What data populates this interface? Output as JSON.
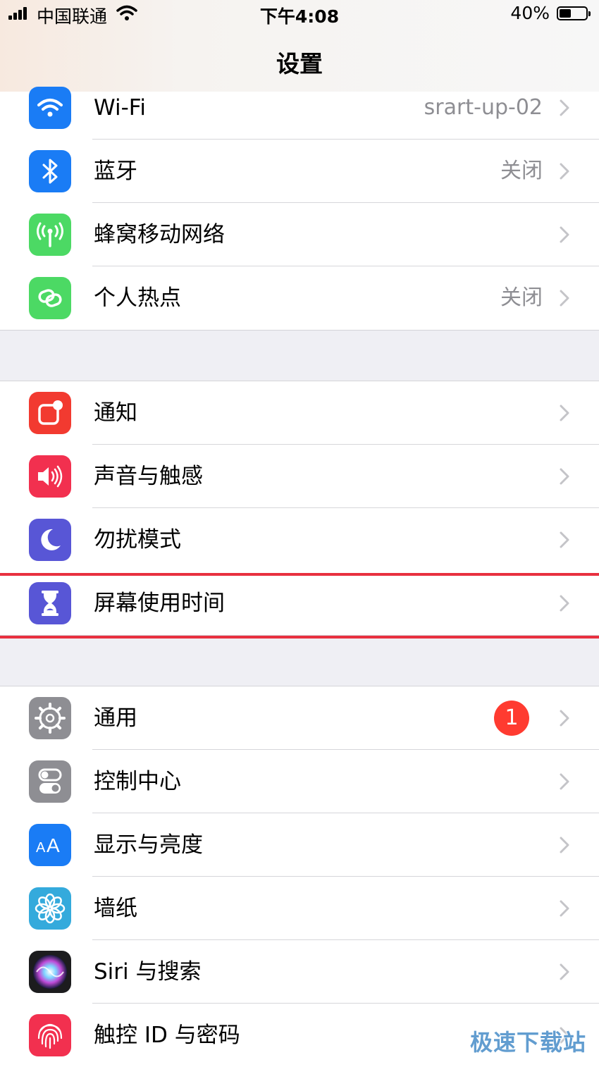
{
  "status_bar": {
    "carrier": "中国联通",
    "time": "下午4:08",
    "battery": "40%",
    "battery_level": 0.4,
    "signal_icon": "signal-bars-icon",
    "wifi_icon": "wifi-icon"
  },
  "nav": {
    "title": "设置"
  },
  "groups": [
    {
      "rows": [
        {
          "label": "Wi-Fi",
          "value": "srart-up-02",
          "icon": "wifi-icon",
          "color": "#1a7cf5"
        },
        {
          "label": "蓝牙",
          "value": "关闭",
          "icon": "bluetooth-icon",
          "color": "#1a7cf5"
        },
        {
          "label": "蜂窝移动网络",
          "value": "",
          "icon": "cellular-antenna-icon",
          "color": "#4cd964"
        },
        {
          "label": "个人热点",
          "value": "关闭",
          "icon": "hotspot-link-icon",
          "color": "#4cd964"
        }
      ]
    },
    {
      "rows": [
        {
          "label": "通知",
          "value": "",
          "icon": "notifications-icon",
          "color": "#f23a30"
        },
        {
          "label": "声音与触感",
          "value": "",
          "icon": "speaker-icon",
          "color": "#f2304f"
        },
        {
          "label": "勿扰模式",
          "value": "",
          "icon": "moon-icon",
          "color": "#5856d6"
        },
        {
          "label": "屏幕使用时间",
          "value": "",
          "icon": "hourglass-icon",
          "color": "#5856d6"
        }
      ]
    },
    {
      "rows": [
        {
          "label": "通用",
          "value": "",
          "badge": "1",
          "icon": "gear-icon",
          "color": "#8e8e93"
        },
        {
          "label": "控制中心",
          "value": "",
          "icon": "toggles-icon",
          "color": "#8e8e93"
        },
        {
          "label": "显示与亮度",
          "value": "",
          "icon": "text-size-icon",
          "color": "#1a7cf5"
        },
        {
          "label": "墙纸",
          "value": "",
          "icon": "flower-icon",
          "color": "#34aadc"
        },
        {
          "label": "Siri 与搜索",
          "value": "",
          "icon": "siri-icon",
          "color": "#222"
        },
        {
          "label": "触控 ID 与密码",
          "value": "",
          "icon": "fingerprint-icon",
          "color": "#f2304f"
        }
      ]
    }
  ],
  "watermark": "极速下载站",
  "highlight_color": "#e8303f"
}
